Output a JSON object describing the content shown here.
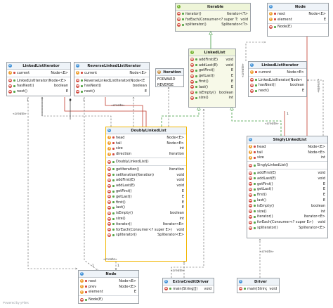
{
  "boxes": {
    "iterable": {
      "title": "Iterable",
      "sections": [
        [
          {
            "icon": "m",
            "vis": "pub",
            "name": "iterator()",
            "type": "Iterator<T>"
          },
          {
            "icon": "m",
            "vis": "pub",
            "name": "forEach(Consumer<? super T>)",
            "type": "void"
          },
          {
            "icon": "m",
            "vis": "pub",
            "name": "spliterator()",
            "type": "Spliterator<T>"
          }
        ]
      ]
    },
    "node_top": {
      "title": "Node",
      "sections": [
        [
          {
            "icon": "f",
            "vis": "priv",
            "name": "next",
            "type": "Node<E>"
          },
          {
            "icon": "f",
            "vis": "priv",
            "name": "element",
            "type": "E"
          }
        ],
        [
          {
            "icon": "m",
            "vis": "pub",
            "name": "Node(E)",
            "type": ""
          }
        ]
      ]
    },
    "linkedlist": {
      "title": "LinkedList",
      "sections": [
        [
          {
            "icon": "m",
            "vis": "pub",
            "name": "addFirst(E)",
            "type": "void"
          },
          {
            "icon": "m",
            "vis": "pub",
            "name": "addLast(E)",
            "type": "void"
          },
          {
            "icon": "m",
            "vis": "pub",
            "name": "getFirst()",
            "type": "E"
          },
          {
            "icon": "m",
            "vis": "pub",
            "name": "getLast()",
            "type": "E"
          },
          {
            "icon": "m",
            "vis": "pub",
            "name": "first()",
            "type": "E"
          },
          {
            "icon": "m",
            "vis": "pub",
            "name": "last()",
            "type": "E"
          },
          {
            "icon": "m",
            "vis": "pub",
            "name": "isEmpty()",
            "type": "boolean"
          },
          {
            "icon": "m",
            "vis": "pub",
            "name": "size()",
            "type": "int"
          }
        ]
      ]
    },
    "lli_left": {
      "title": "LinkedListIterator",
      "sections": [
        [
          {
            "icon": "f",
            "vis": "priv",
            "name": "current",
            "type": "Node<E>"
          }
        ],
        [
          {
            "icon": "m",
            "vis": "pub",
            "name": "LinkedListIterator(Node<E>)",
            "type": ""
          },
          {
            "icon": "m",
            "vis": "pub",
            "name": "hasNext()",
            "type": "boolean"
          },
          {
            "icon": "m",
            "vis": "pub",
            "name": "next()",
            "type": "E"
          }
        ]
      ]
    },
    "rli": {
      "title": "ReverseLinkedListIterator",
      "sections": [
        [
          {
            "icon": "f",
            "vis": "priv",
            "name": "current",
            "type": "Node<E>"
          }
        ],
        [
          {
            "icon": "m",
            "vis": "pub",
            "name": "ReverseLinkedListIterator(Node<E>)",
            "type": ""
          },
          {
            "icon": "m",
            "vis": "pub",
            "name": "hasNext()",
            "type": "boolean"
          },
          {
            "icon": "m",
            "vis": "pub",
            "name": "next()",
            "type": "E"
          }
        ]
      ]
    },
    "iteration": {
      "title": "Iteration",
      "plain": [
        "FORWARD",
        "REVERSE"
      ]
    },
    "lli_right": {
      "title": "LinkedListIterator",
      "sections": [
        [
          {
            "icon": "f",
            "vis": "priv",
            "name": "current",
            "type": "Node<E>"
          }
        ],
        [
          {
            "icon": "m",
            "vis": "pub",
            "name": "LinkedListIterator(Node<E>)",
            "type": ""
          },
          {
            "icon": "m",
            "vis": "pub",
            "name": "hasNext()",
            "type": "boolean"
          },
          {
            "icon": "m",
            "vis": "pub",
            "name": "next()",
            "type": "E"
          }
        ]
      ]
    },
    "dll": {
      "title": "DoublyLinkedList",
      "sections": [
        [
          {
            "icon": "f",
            "vis": "priv",
            "name": "head",
            "type": "Node<E>"
          },
          {
            "icon": "f",
            "vis": "priv",
            "name": "tail",
            "type": "Node<E>"
          },
          {
            "icon": "f",
            "vis": "priv",
            "name": "size",
            "type": "int"
          },
          {
            "icon": "f",
            "vis": "priv",
            "name": "direction",
            "type": "Iteration"
          }
        ],
        [
          {
            "icon": "m",
            "vis": "pub",
            "name": "DoublyLinkedList()",
            "type": ""
          }
        ],
        [
          {
            "icon": "m",
            "vis": "pub",
            "name": "getIteration()",
            "type": "Iteration"
          },
          {
            "icon": "m",
            "vis": "pub",
            "name": "setIteration(Iteration)",
            "type": "void"
          },
          {
            "icon": "m",
            "vis": "pub",
            "name": "addFirst(E)",
            "type": "void"
          },
          {
            "icon": "m",
            "vis": "pub",
            "name": "addLast(E)",
            "type": "void"
          },
          {
            "icon": "m",
            "vis": "pub",
            "name": "getFirst()",
            "type": "E"
          },
          {
            "icon": "m",
            "vis": "pub",
            "name": "getLast()",
            "type": "E"
          },
          {
            "icon": "m",
            "vis": "pub",
            "name": "first()",
            "type": "E"
          },
          {
            "icon": "m",
            "vis": "pub",
            "name": "last()",
            "type": "E"
          },
          {
            "icon": "m",
            "vis": "pub",
            "name": "isEmpty()",
            "type": "boolean"
          },
          {
            "icon": "m",
            "vis": "pub",
            "name": "size()",
            "type": "int"
          },
          {
            "icon": "m",
            "vis": "pub",
            "name": "iterator()",
            "type": "Iterator<E>"
          },
          {
            "icon": "m",
            "vis": "pub",
            "name": "forEach(Consumer<? super E>)",
            "type": "void"
          },
          {
            "icon": "m",
            "vis": "pub",
            "name": "spliterator()",
            "type": "Spliterator<E>"
          }
        ]
      ]
    },
    "sll": {
      "title": "SinglyLinkedList",
      "sections": [
        [
          {
            "icon": "f",
            "vis": "priv",
            "name": "head",
            "type": "Node<E>"
          },
          {
            "icon": "f",
            "vis": "priv",
            "name": "tail",
            "type": "Node<E>"
          },
          {
            "icon": "f",
            "vis": "priv",
            "name": "size",
            "type": "int"
          }
        ],
        [
          {
            "icon": "m",
            "vis": "pub",
            "name": "SinglyLinkedList()",
            "type": ""
          }
        ],
        [
          {
            "icon": "m",
            "vis": "pub",
            "name": "addFirst(E)",
            "type": "void"
          },
          {
            "icon": "m",
            "vis": "pub",
            "name": "addLast(E)",
            "type": "void"
          },
          {
            "icon": "m",
            "vis": "pub",
            "name": "getFirst()",
            "type": "E"
          },
          {
            "icon": "m",
            "vis": "pub",
            "name": "getLast()",
            "type": "E"
          },
          {
            "icon": "m",
            "vis": "pub",
            "name": "first()",
            "type": "E"
          },
          {
            "icon": "m",
            "vis": "pub",
            "name": "last()",
            "type": "E"
          },
          {
            "icon": "m",
            "vis": "pub",
            "name": "isEmpty()",
            "type": "boolean"
          },
          {
            "icon": "m",
            "vis": "pub",
            "name": "size()",
            "type": "int"
          },
          {
            "icon": "m",
            "vis": "pub",
            "name": "iterator()",
            "type": "Iterator<E>"
          },
          {
            "icon": "m",
            "vis": "pub",
            "name": "forEach(Consumer<? super E>)",
            "type": "void"
          },
          {
            "icon": "m",
            "vis": "pub",
            "name": "spliterator()",
            "type": "Spliterator<E>"
          }
        ]
      ]
    },
    "node_bottom": {
      "title": "Node",
      "sections": [
        [
          {
            "icon": "f",
            "vis": "priv",
            "name": "next",
            "type": "Node<E>"
          },
          {
            "icon": "f",
            "vis": "priv",
            "name": "prev",
            "type": "Node<E>"
          },
          {
            "icon": "f",
            "vis": "priv",
            "name": "element",
            "type": "E"
          }
        ],
        [
          {
            "icon": "m",
            "vis": "pub",
            "name": "Node(E)",
            "type": ""
          }
        ]
      ]
    },
    "ecd": {
      "title": "ExtraCreditDriver",
      "sections": [
        [
          {
            "icon": "m",
            "vis": "pub",
            "name": "main(String[])",
            "type": "void"
          }
        ]
      ]
    },
    "driver": {
      "title": "Driver",
      "sections": [
        [
          {
            "icon": "m",
            "vis": "pub",
            "name": "main(String[])",
            "type": "void"
          }
        ]
      ]
    }
  },
  "labels": {
    "create": "«create»",
    "one": "1"
  },
  "footer": "Powered by yFiles",
  "colors": {
    "inheritance": "#3b9a3b",
    "composition": "#c0392b",
    "dependency": "#555555"
  }
}
